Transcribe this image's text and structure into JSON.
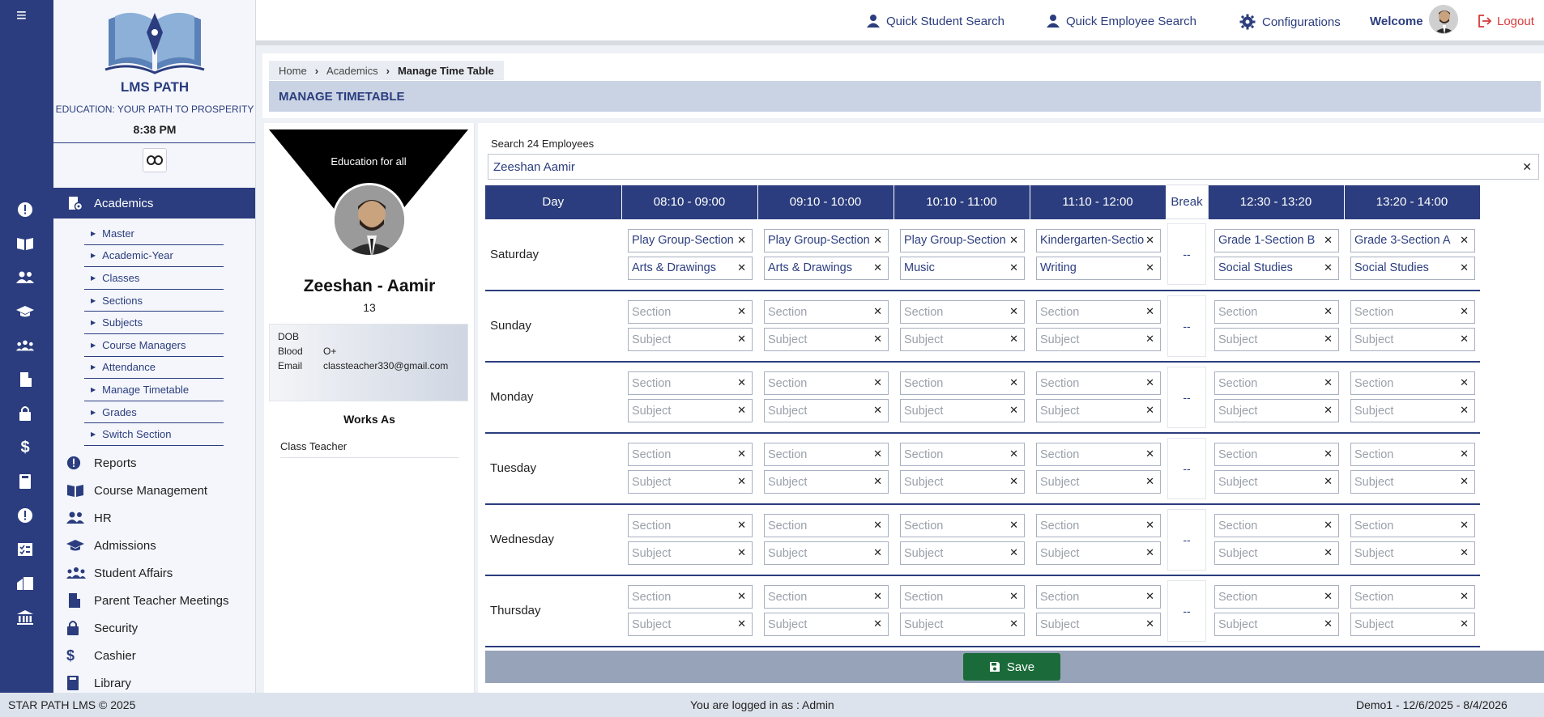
{
  "app": {
    "name": "LMS PATH",
    "tagline": "EDUCATION: YOUR PATH TO PROSPERITY",
    "time": "8:38 PM"
  },
  "topbar": {
    "quick_student_search": "Quick Student Search",
    "quick_employee_search": "Quick Employee Search",
    "configurations": "Configurations",
    "welcome": "Welcome",
    "logout": "Logout"
  },
  "sidebar": {
    "active": "Academics",
    "subitems": [
      "Master",
      "Academic-Year",
      "Classes",
      "Sections",
      "Subjects",
      "Course Managers",
      "Attendance",
      "Manage Timetable",
      "Grades",
      "Switch Section"
    ],
    "items": [
      "Reports",
      "Course Management",
      "HR",
      "Admissions",
      "Student Affairs",
      "Parent Teacher Meetings",
      "Security",
      "Cashier",
      "Library"
    ]
  },
  "breadcrumb": [
    "Home",
    "Academics",
    "Manage Time Table"
  ],
  "page_title": "MANAGE TIMETABLE",
  "profile": {
    "banner": "Education for all",
    "name": "Zeeshan - Aamir",
    "id": "13",
    "dob_label": "DOB",
    "dob": "",
    "blood_label": "Blood",
    "blood": "O+",
    "email_label": "Email",
    "email": "classteacher330@gmail.com",
    "works_as_title": "Works As",
    "works_as": "Class Teacher"
  },
  "search": {
    "label": "Search 24 Employees",
    "value": "Zeeshan Aamir"
  },
  "timetable": {
    "headers": [
      "Day",
      "08:10 - 09:00",
      "09:10 - 10:00",
      "10:10 - 11:00",
      "11:10 - 12:00",
      "Break",
      "12:30 - 13:20",
      "13:20 - 14:00"
    ],
    "break_text": "--",
    "section_placeholder": "Section",
    "subject_placeholder": "Subject",
    "days": [
      {
        "day": "Saturday",
        "slots": [
          {
            "section": "Play Group-Section A",
            "subject": "Arts & Drawings"
          },
          {
            "section": "Play Group-Section A",
            "subject": "Arts & Drawings"
          },
          {
            "section": "Play Group-Section A",
            "subject": "Music"
          },
          {
            "section": "Kindergarten-Section A",
            "subject": "Writing"
          },
          {
            "section": "Grade 1-Section B",
            "subject": "Social Studies"
          },
          {
            "section": "Grade 3-Section A",
            "subject": "Social Studies"
          }
        ]
      },
      {
        "day": "Sunday",
        "slots": [
          {
            "section": "",
            "subject": ""
          },
          {
            "section": "",
            "subject": ""
          },
          {
            "section": "",
            "subject": ""
          },
          {
            "section": "",
            "subject": ""
          },
          {
            "section": "",
            "subject": ""
          },
          {
            "section": "",
            "subject": ""
          }
        ]
      },
      {
        "day": "Monday",
        "slots": [
          {
            "section": "",
            "subject": ""
          },
          {
            "section": "",
            "subject": ""
          },
          {
            "section": "",
            "subject": ""
          },
          {
            "section": "",
            "subject": ""
          },
          {
            "section": "",
            "subject": ""
          },
          {
            "section": "",
            "subject": ""
          }
        ]
      },
      {
        "day": "Tuesday",
        "slots": [
          {
            "section": "",
            "subject": ""
          },
          {
            "section": "",
            "subject": ""
          },
          {
            "section": "",
            "subject": ""
          },
          {
            "section": "",
            "subject": ""
          },
          {
            "section": "",
            "subject": ""
          },
          {
            "section": "",
            "subject": ""
          }
        ]
      },
      {
        "day": "Wednesday",
        "slots": [
          {
            "section": "",
            "subject": ""
          },
          {
            "section": "",
            "subject": ""
          },
          {
            "section": "",
            "subject": ""
          },
          {
            "section": "",
            "subject": ""
          },
          {
            "section": "",
            "subject": ""
          },
          {
            "section": "",
            "subject": ""
          }
        ]
      },
      {
        "day": "Thursday",
        "slots": [
          {
            "section": "",
            "subject": ""
          },
          {
            "section": "",
            "subject": ""
          },
          {
            "section": "",
            "subject": ""
          },
          {
            "section": "",
            "subject": ""
          },
          {
            "section": "",
            "subject": ""
          },
          {
            "section": "",
            "subject": ""
          }
        ]
      }
    ]
  },
  "save_label": "Save",
  "footer": {
    "copyright": "STAR PATH LMS © 2025",
    "logged_in": "You are logged in as : Admin",
    "session": "Demo1 - 12/6/2025 - 8/4/2026"
  },
  "colors": {
    "primary": "#2b3d7e",
    "save": "#1b6b3a",
    "logout": "#d63a3a"
  }
}
